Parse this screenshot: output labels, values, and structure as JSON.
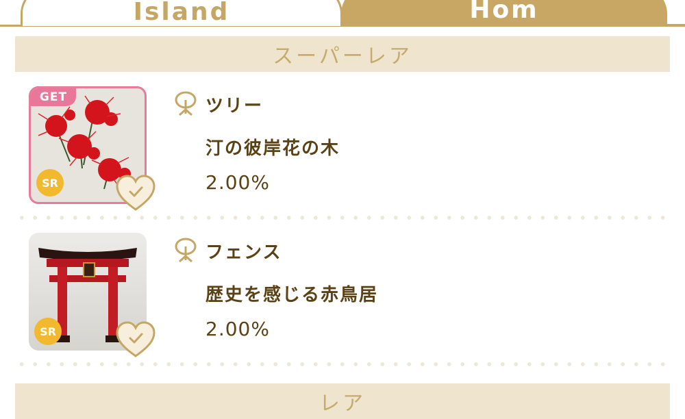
{
  "tabs": [
    {
      "label": "Island",
      "active": false
    },
    {
      "label": "Hom",
      "active": true
    }
  ],
  "sections": [
    {
      "title": "スーパーレア"
    },
    {
      "title": "レア"
    }
  ],
  "items": [
    {
      "badge": "GET",
      "rarity": "SR",
      "category": "ツリー",
      "name": "汀の彼岸花の木",
      "rate": "2.00%",
      "thumb_icon": "red-spider-lily-tree-image"
    },
    {
      "badge": "",
      "rarity": "SR",
      "category": "フェンス",
      "name": "歴史を感じる赤鳥居",
      "rate": "2.00%",
      "thumb_icon": "red-torii-gate-image"
    }
  ],
  "colors": {
    "gold": "#c5a765",
    "section_bg": "#efe5cf",
    "text_brown": "#5a4215",
    "owned_border": "#e87a9b",
    "sr_badge": "#f2b92f"
  }
}
